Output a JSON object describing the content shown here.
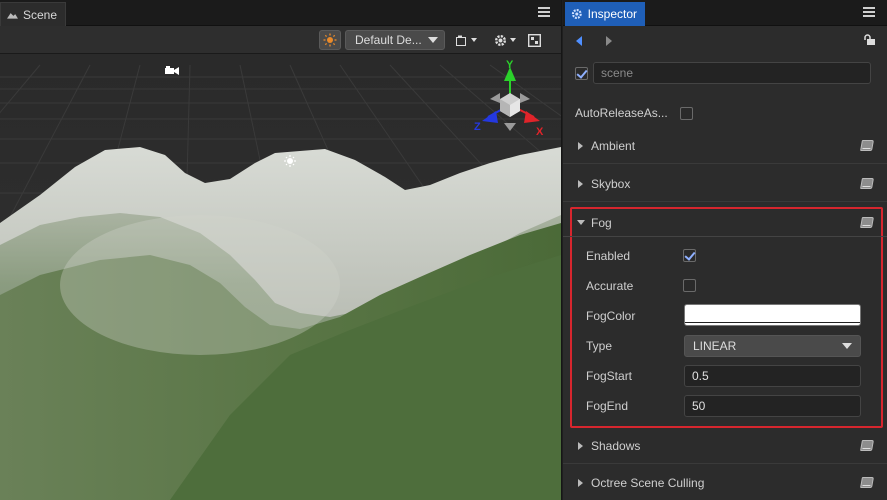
{
  "scene_panel": {
    "tab_label": "Scene",
    "toolbar": {
      "camera_dropdown": "Default De..."
    }
  },
  "inspector": {
    "tab_label": "Inspector",
    "node_name": "scene",
    "auto_release_label": "AutoReleaseAs...",
    "sections": {
      "ambient": "Ambient",
      "skybox": "Skybox",
      "fog": "Fog",
      "shadows": "Shadows",
      "octree": "Octree Scene Culling"
    },
    "fog": {
      "enabled_label": "Enabled",
      "accurate_label": "Accurate",
      "fogcolor_label": "FogColor",
      "type_label": "Type",
      "type_value": "LINEAR",
      "fogstart_label": "FogStart",
      "fogstart_value": "0.5",
      "fogend_label": "FogEnd",
      "fogend_value": "50",
      "fog_color": "#ffffff"
    }
  },
  "gizmo": {
    "x_label": "X",
    "y_label": "Y",
    "z_label": "Z"
  },
  "colors": {
    "accent": "#1f5fb8",
    "highlight_border": "#d7262e"
  }
}
